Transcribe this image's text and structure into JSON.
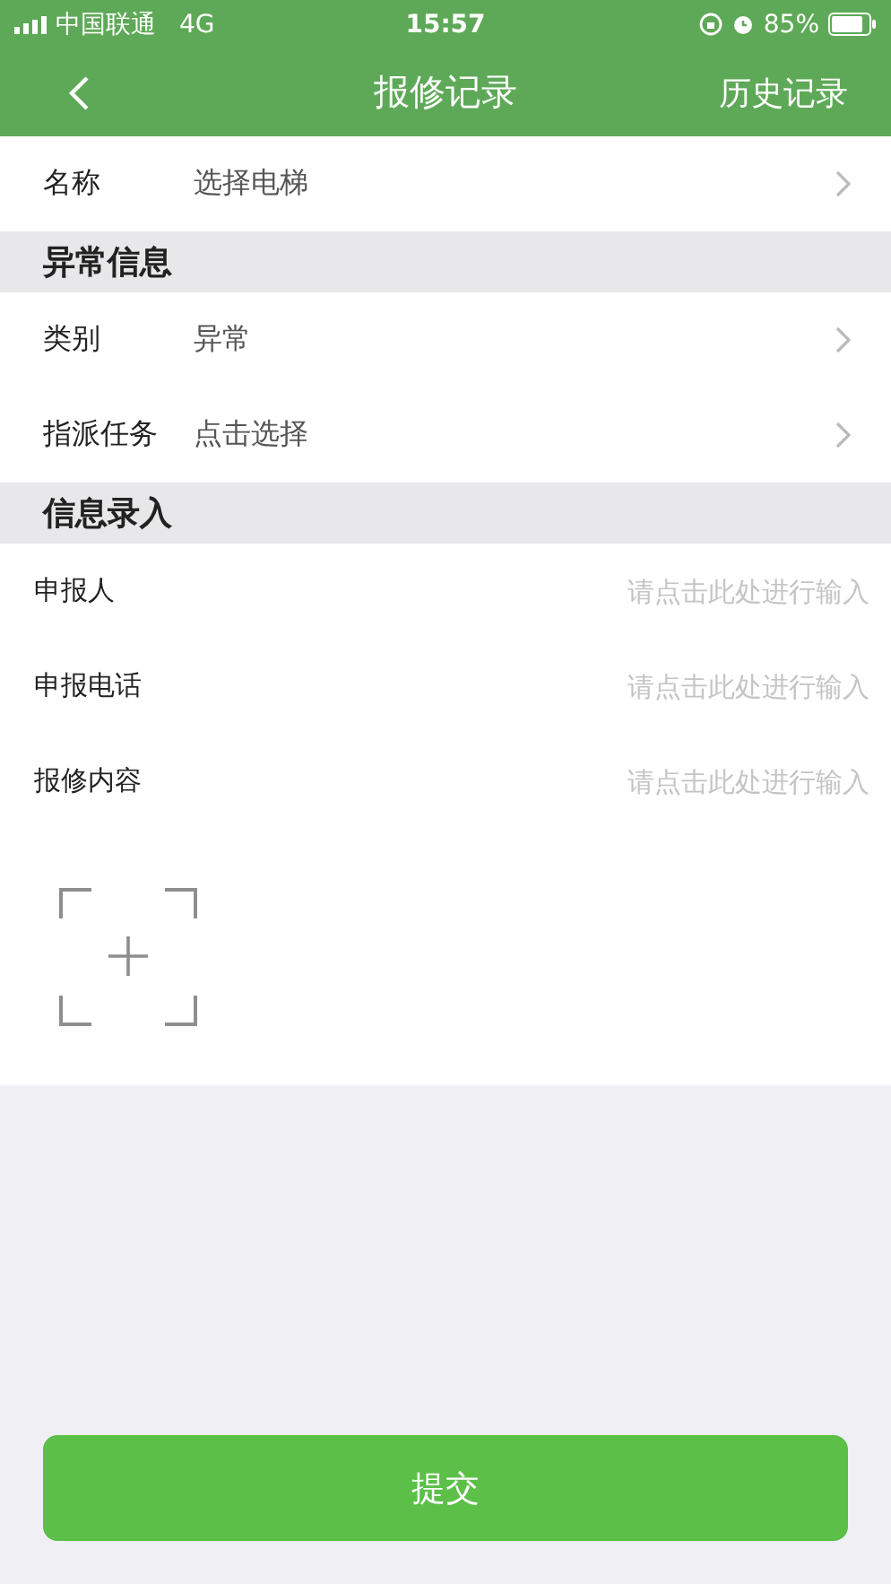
{
  "status_bar": {
    "carrier": "中国联通",
    "network": "4G",
    "time": "15:57",
    "battery": "85%"
  },
  "nav_bar": {
    "title": "报修记录",
    "action": "历史记录"
  },
  "form": [
    {
      "kind": "picker",
      "label": "名称",
      "value": "选择电梯"
    },
    {
      "kind": "header",
      "label": "异常信息"
    },
    {
      "kind": "picker",
      "label": "类别",
      "value": "异常"
    },
    {
      "kind": "picker",
      "label": "指派任务",
      "value": "点击选择"
    },
    {
      "kind": "header",
      "label": "信息录入"
    },
    {
      "kind": "input",
      "label": "申报人",
      "placeholder": "请点击此处进行输入"
    },
    {
      "kind": "input",
      "label": "申报电话",
      "placeholder": "请点击此处进行输入"
    },
    {
      "kind": "input",
      "label": "报修内容",
      "placeholder": "请点击此处进行输入"
    },
    {
      "kind": "upload"
    }
  ],
  "submit": {
    "label": "提交"
  }
}
